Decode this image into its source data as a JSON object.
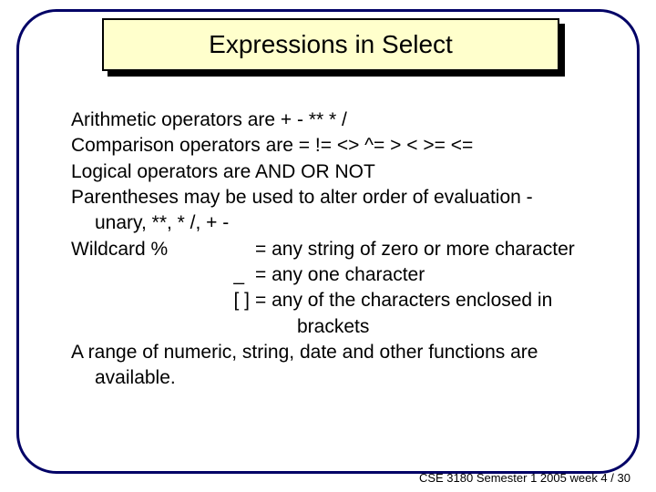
{
  "title": "Expressions in Select",
  "body": {
    "arithmetic": "Arithmetic operators  are +  -  **  *  /",
    "comparison": "Comparison operators are   =   !=  <>  ^=  >  <  >=  <=",
    "logical": "Logical operators  are AND  OR  NOT",
    "parens_1": "Parentheses may be used to alter  order of evaluation -",
    "parens_2": "unary, **, * /, + -",
    "wildcard_lead": "Wildcard   %",
    "wildcard_pct": "= any string of zero or more character",
    "wildcard_underscore_lead": "_",
    "wildcard_underscore": "  = any one character",
    "wildcard_bracket_lead": "[  ]",
    "wildcard_bracket_a": "= any of the characters enclosed in",
    "wildcard_bracket_b": "brackets",
    "range_1": "A range of numeric, string, date and other functions are",
    "range_2": "available."
  },
  "footer": {
    "course": "CSE 3180",
    "term": "Semester 1 2005",
    "week": "week 4",
    "page_sep": " / ",
    "page": "30"
  }
}
